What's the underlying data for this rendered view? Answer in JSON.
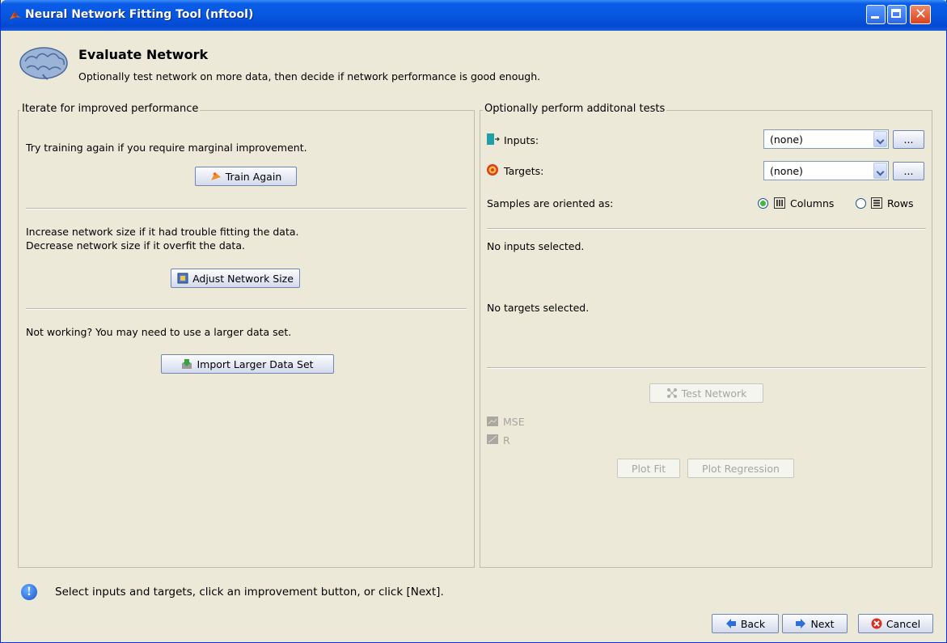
{
  "window": {
    "title": "Neural Network Fitting Tool (nftool)"
  },
  "header": {
    "title": "Evaluate Network",
    "subtitle": "Optionally test network on more data, then decide if network performance is good enough."
  },
  "left_panel": {
    "legend": "Iterate for improved performance",
    "train_text": "Try training again if you require marginal improvement.",
    "train_button": "Train Again",
    "size_text_1": "Increase network size if it had trouble fitting the data.",
    "size_text_2": "Decrease network size if it overfit the data.",
    "size_button": "Adjust Network Size",
    "data_text": "Not working? You may need to use a larger data set.",
    "data_button": "Import Larger Data Set"
  },
  "right_panel": {
    "legend": "Optionally perform additonal tests",
    "inputs_label": "Inputs:",
    "inputs_value": "(none)",
    "targets_label": "Targets:",
    "targets_value": "(none)",
    "browse_label": "...",
    "orientation_label": "Samples are oriented as:",
    "columns_label": "Columns",
    "rows_label": "Rows",
    "orientation_selected": "Columns",
    "no_inputs": "No inputs selected.",
    "no_targets": "No targets selected.",
    "test_button": "Test Network",
    "mse_label": "MSE",
    "r_label": "R",
    "plot_fit_button": "Plot Fit",
    "plot_regression_button": "Plot Regression"
  },
  "status": {
    "message": "Select inputs and targets, click an improvement button, or click [Next]."
  },
  "footer": {
    "back": "Back",
    "next": "Next",
    "cancel": "Cancel"
  }
}
